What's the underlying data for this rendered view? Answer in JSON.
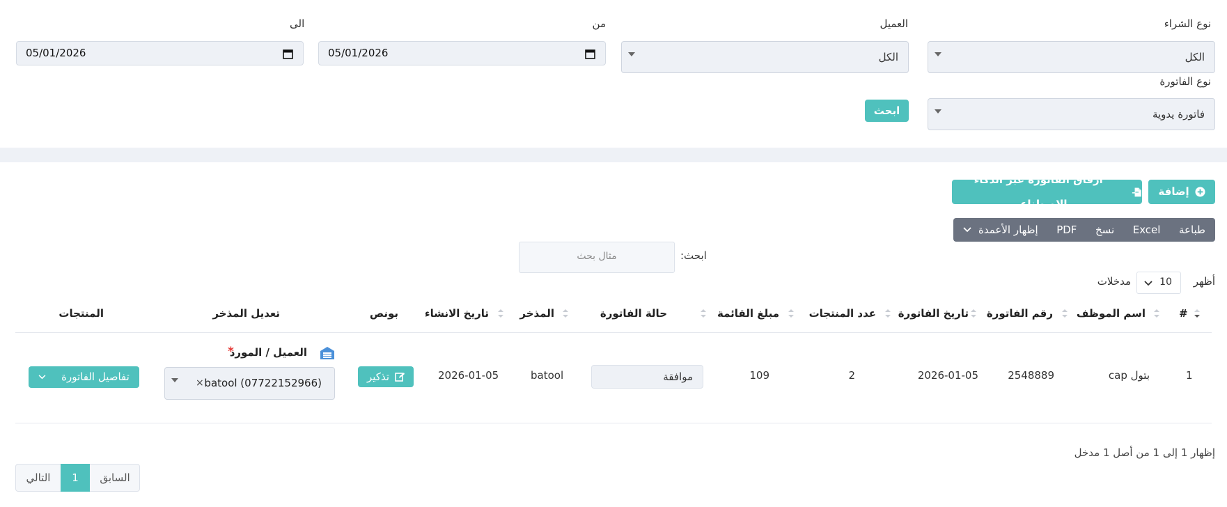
{
  "filters": {
    "purchase_type_label": "نوع الشراء",
    "purchase_type_value": "الكل",
    "customer_label": "العميل",
    "customer_value": "الكل",
    "from_label": "من",
    "from_value": "05/01/2026",
    "to_label": "الى",
    "to_value": "05/01/2026",
    "invoice_type_label": "نوع الفاتورة",
    "invoice_type_value": "فاتورة يدوية",
    "search_button": "ابحث"
  },
  "actions": {
    "add_label": "إضافة",
    "attach_ai_label": "ارفاق الفاتورة عبر الذكاء الاصطناعي"
  },
  "toolbar": {
    "print": "طباعة",
    "excel": "Excel",
    "copy": "نسخ",
    "pdf": "PDF",
    "columns": "إظهار الأعمدة"
  },
  "table_search": {
    "label": "ابحث:",
    "placeholder": "مثال بحث"
  },
  "length": {
    "show_label": "أظهر",
    "value": "10",
    "entries_label": "مدخلات"
  },
  "table": {
    "headers": {
      "num": "#",
      "employee": "اسم الموظف",
      "invoice_no": "رقم الفاتورة",
      "invoice_date": "تاريخ الفاتورة",
      "products_count": "عدد المنتجات",
      "amount": "مبلغ القائمة",
      "status": "حالة الفاتورة",
      "saved_by": "المذخر",
      "created": "تاريخ الانشاء",
      "bonus": "بونص",
      "edit_saver": "تعديل المذخر",
      "products": "المنتجات"
    },
    "rows": [
      {
        "num": "1",
        "employee": "بتول cap",
        "invoice_no": "2548889",
        "invoice_date": "2026-01-05",
        "products_count": "2",
        "amount": "109",
        "status": "موافقة",
        "saved_by": "batool",
        "created": "2026-01-05",
        "bonus_button": "تذكير",
        "client_label": "العميل / المورد",
        "required_mark": "*",
        "client_value": "batool (07722152966)",
        "clear_mark": "×",
        "details_button": "تفاصيل الفاتورة"
      }
    ]
  },
  "footer": {
    "info": "إظهار 1 إلى 1 من أصل 1 مدخل",
    "prev": "السابق",
    "page": "1",
    "next": "التالي"
  },
  "colors": {
    "accent": "#4fc1bd",
    "toolbar": "#6b7280",
    "field_bg": "#eef1f6",
    "required": "#e53935"
  }
}
